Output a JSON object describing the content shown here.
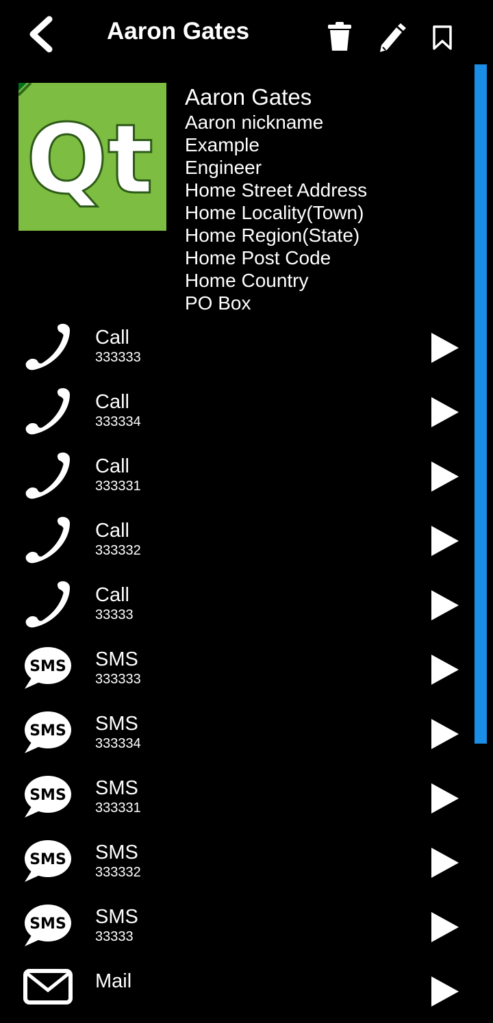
{
  "header": {
    "title": "Aaron Gates",
    "icons": [
      "back-arrow-icon",
      "trash-icon",
      "pencil-icon",
      "bookmark-icon"
    ]
  },
  "contact": {
    "avatar": "qt-logo",
    "name": "Aaron Gates",
    "nickname": "Aaron nickname",
    "company": "Example",
    "title": "Engineer",
    "street": "Home Street Address",
    "locality": "Home Locality(Town)",
    "region": "Home Region(State)",
    "postcode": "Home Post Code",
    "country": "Home Country",
    "pobox": "PO Box"
  },
  "actions": [
    {
      "label": "Call",
      "value": "333333",
      "icon": "phone-icon"
    },
    {
      "label": "Call",
      "value": "333334",
      "icon": "phone-icon"
    },
    {
      "label": "Call",
      "value": "333331",
      "icon": "phone-icon"
    },
    {
      "label": "Call",
      "value": "333332",
      "icon": "phone-icon"
    },
    {
      "label": "Call",
      "value": "33333",
      "icon": "phone-icon"
    },
    {
      "label": "SMS",
      "value": "333333",
      "icon": "sms-icon"
    },
    {
      "label": "SMS",
      "value": "333334",
      "icon": "sms-icon"
    },
    {
      "label": "SMS",
      "value": "333331",
      "icon": "sms-icon"
    },
    {
      "label": "SMS",
      "value": "333332",
      "icon": "sms-icon"
    },
    {
      "label": "SMS",
      "value": "33333",
      "icon": "sms-icon"
    },
    {
      "label": "Mail",
      "value": "",
      "icon": "mail-icon"
    }
  ],
  "colors": {
    "background": "#000000",
    "text": "#ffffff",
    "scrollbar": "#1a8ee6",
    "qt_green": "#7dbd41"
  }
}
